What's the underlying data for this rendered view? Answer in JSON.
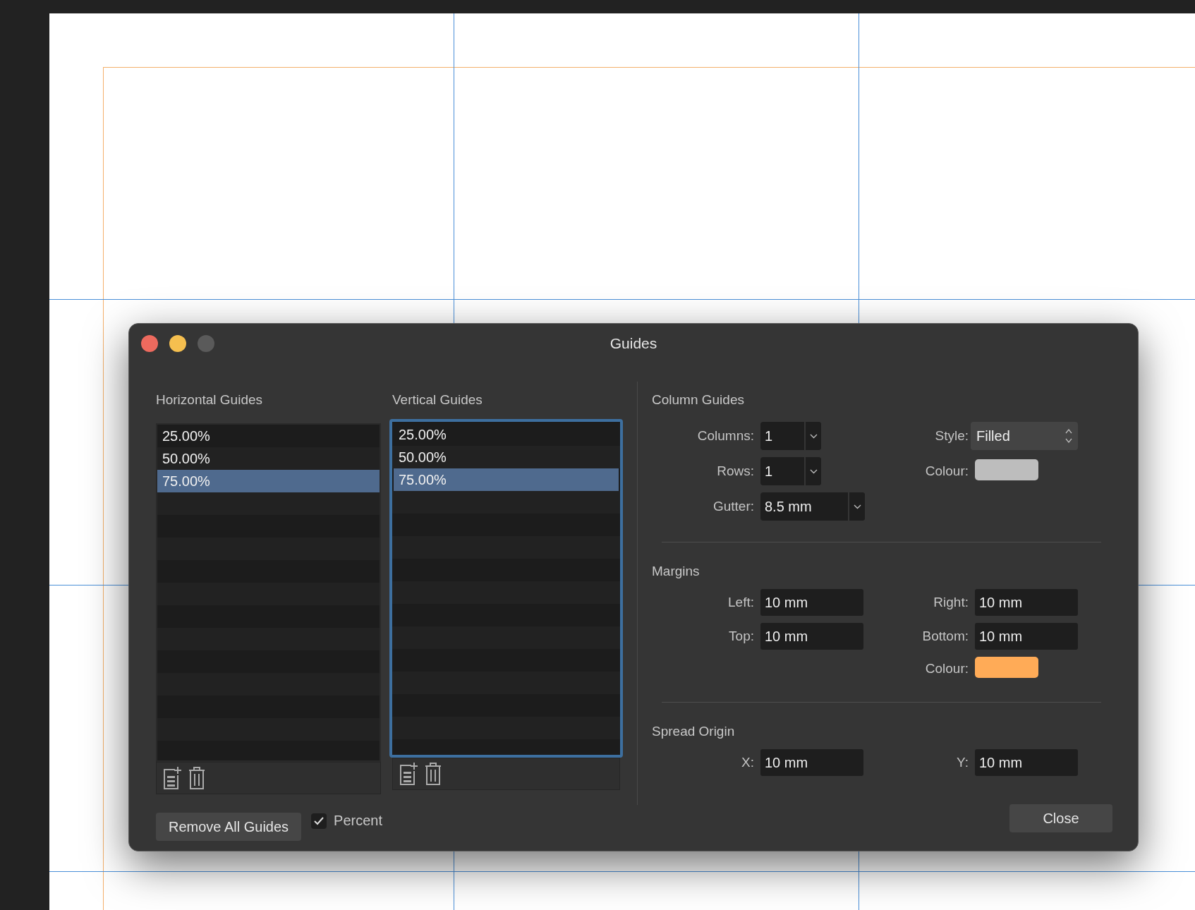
{
  "window": {
    "title": "Guides"
  },
  "horizontal_guides": {
    "label": "Horizontal Guides",
    "focused": false,
    "items": [
      {
        "value": "25.00%",
        "selected": false
      },
      {
        "value": "50.00%",
        "selected": false
      },
      {
        "value": "75.00%",
        "selected": true
      }
    ]
  },
  "vertical_guides": {
    "label": "Vertical Guides",
    "focused": true,
    "items": [
      {
        "value": "25.00%",
        "selected": false
      },
      {
        "value": "50.00%",
        "selected": false
      },
      {
        "value": "75.00%",
        "selected": true
      }
    ]
  },
  "column_guides": {
    "title": "Column Guides",
    "columns": {
      "label": "Columns:",
      "value": "1"
    },
    "rows": {
      "label": "Rows:",
      "value": "1"
    },
    "gutter": {
      "label": "Gutter:",
      "value": "8.5 mm"
    },
    "style": {
      "label": "Style:",
      "value": "Filled"
    },
    "colour": {
      "label": "Colour:",
      "color": "#bdbdbd"
    }
  },
  "margins": {
    "title": "Margins",
    "left": {
      "label": "Left:",
      "value": "10 mm"
    },
    "right": {
      "label": "Right:",
      "value": "10 mm"
    },
    "top": {
      "label": "Top:",
      "value": "10 mm"
    },
    "bottom": {
      "label": "Bottom:",
      "value": "10 mm"
    },
    "colour": {
      "label": "Colour:",
      "color": "#ffab57"
    }
  },
  "spread_origin": {
    "title": "Spread Origin",
    "x": {
      "label": "X:",
      "value": "10 mm"
    },
    "y": {
      "label": "Y:",
      "value": "10 mm"
    }
  },
  "remove_all_button": "Remove All Guides",
  "percent": {
    "label": "Percent",
    "checked": true
  },
  "close_button": "Close"
}
